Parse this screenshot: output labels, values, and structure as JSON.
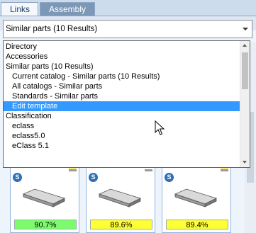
{
  "tabs": [
    {
      "label": "Links",
      "active": true
    },
    {
      "label": "Assembly",
      "active": false
    }
  ],
  "combo": {
    "value": "Similar parts (10 Results)"
  },
  "dropdown": {
    "items": [
      {
        "label": "Directory",
        "indent": 0
      },
      {
        "label": "Accessories",
        "indent": 0
      },
      {
        "label": "Similar parts (10 Results)",
        "indent": 0
      },
      {
        "label": "Current catalog - Similar parts (10 Results)",
        "indent": 1
      },
      {
        "label": "All catalogs - Similar parts",
        "indent": 1
      },
      {
        "label": "Standards - Similar parts",
        "indent": 1
      },
      {
        "label": "Edit template",
        "indent": 1,
        "selected": true
      },
      {
        "label": "Classification",
        "indent": 0
      },
      {
        "label": "eclass",
        "indent": 1
      },
      {
        "label": "eclass5.0",
        "indent": 1
      },
      {
        "label": "eClass 5.1",
        "indent": 1
      }
    ]
  },
  "results": [
    {
      "score": "90.7%",
      "score_color": "green",
      "flag": "de",
      "badge": "S"
    },
    {
      "score": "89.6%",
      "score_color": "yellow",
      "flag": "us",
      "badge": "S"
    },
    {
      "score": "89.4%",
      "score_color": "yellow",
      "flag": "de",
      "badge": "S"
    }
  ],
  "colors": {
    "selection": "#3399ff",
    "score_green": "#7cfc6c",
    "score_yellow": "#ffff33"
  }
}
